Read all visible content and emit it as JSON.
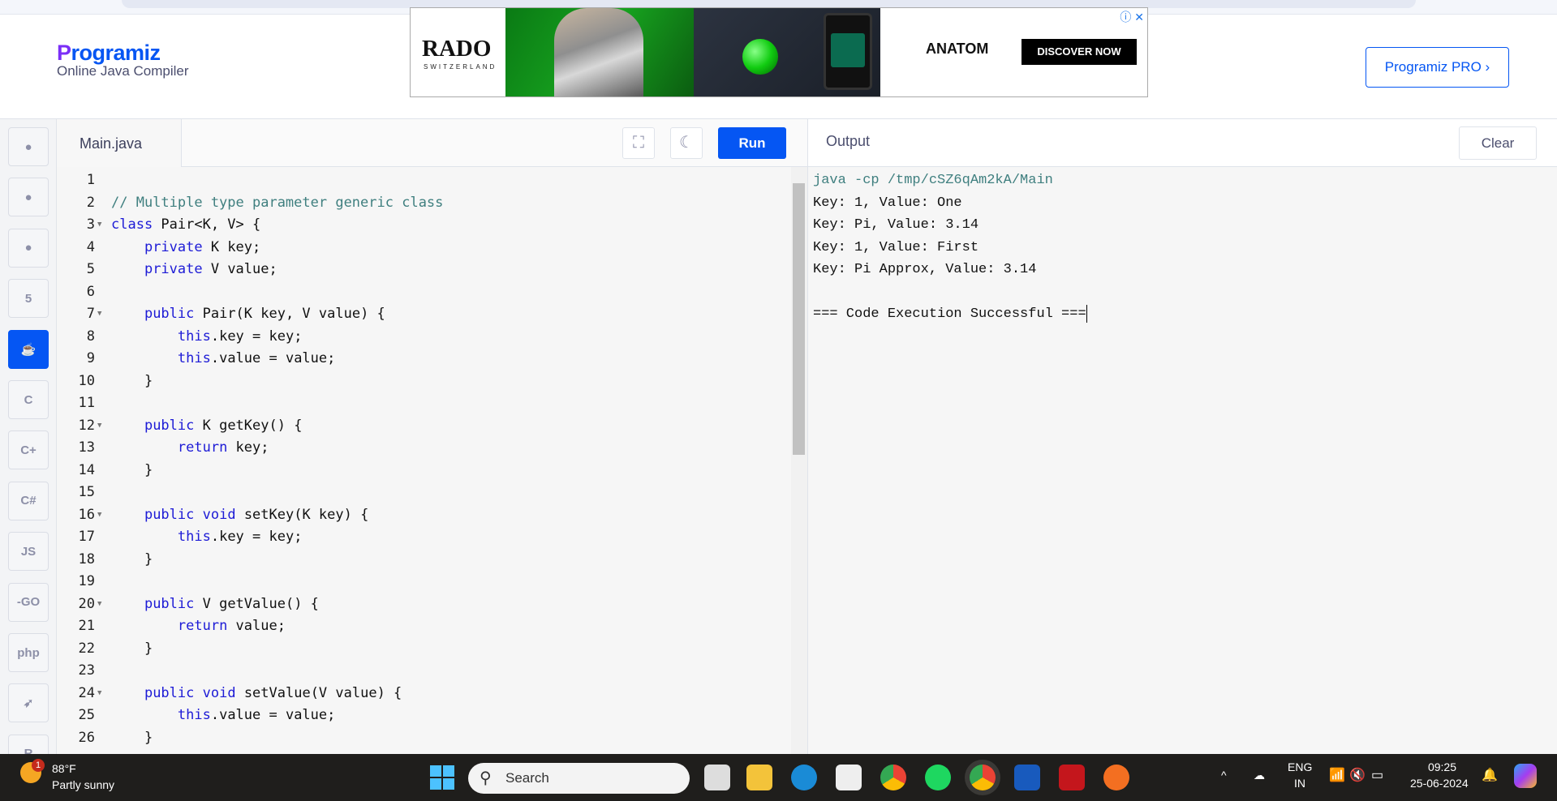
{
  "header": {
    "logo": "Programiz",
    "subtitle": "Online Java Compiler",
    "pro_button": "Programiz PRO ›",
    "ad": {
      "brand": "RADO",
      "brand_sub": "SWITZERLAND",
      "model": "ANATOM",
      "cta": "DISCOVER NOW"
    }
  },
  "sidebar": {
    "items": [
      {
        "icon": "python-icon"
      },
      {
        "icon": "r-icon"
      },
      {
        "icon": "sql-icon"
      },
      {
        "icon": "html5-icon",
        "label": "5"
      },
      {
        "icon": "java-icon",
        "label": "☕",
        "active": true
      },
      {
        "icon": "c-icon",
        "label": "C"
      },
      {
        "icon": "cpp-icon",
        "label": "C+"
      },
      {
        "icon": "csharp-icon",
        "label": "C#"
      },
      {
        "icon": "js-icon",
        "label": "JS"
      },
      {
        "icon": "go-icon",
        "label": "-GO"
      },
      {
        "icon": "php-icon",
        "label": "php"
      },
      {
        "icon": "swift-icon",
        "label": "➶"
      },
      {
        "icon": "rust-icon",
        "label": "R"
      }
    ]
  },
  "editor": {
    "tab": "Main.java",
    "run_label": "Run",
    "lines": [
      "",
      "// Multiple type parameter generic class",
      "class Pair<K, V> {",
      "    private K key;",
      "    private V value;",
      "",
      "    public Pair(K key, V value) {",
      "        this.key = key;",
      "        this.value = value;",
      "    }",
      "",
      "    public K getKey() {",
      "        return key;",
      "    }",
      "",
      "    public void setKey(K key) {",
      "        this.key = key;",
      "    }",
      "",
      "    public V getValue() {",
      "        return value;",
      "    }",
      "",
      "    public void setValue(V value) {",
      "        this.value = value;",
      "    }"
    ],
    "fold_lines": [
      3,
      7,
      12,
      16,
      20,
      24
    ]
  },
  "output": {
    "label": "Output",
    "clear_label": "Clear",
    "lines": [
      "java -cp /tmp/cSZ6qAm2kA/Main",
      "Key: 1, Value: One",
      "Key: Pi, Value: 3.14",
      "Key: 1, Value: First",
      "Key: Pi Approx, Value: 3.14",
      "",
      "=== Code Execution Successful ==="
    ]
  },
  "taskbar": {
    "weather_temp": "88°F",
    "weather_desc": "Partly sunny",
    "weather_badge": "1",
    "search": "Search",
    "lang": "ENG",
    "region": "IN",
    "time": "09:25",
    "date": "25-06-2024"
  }
}
